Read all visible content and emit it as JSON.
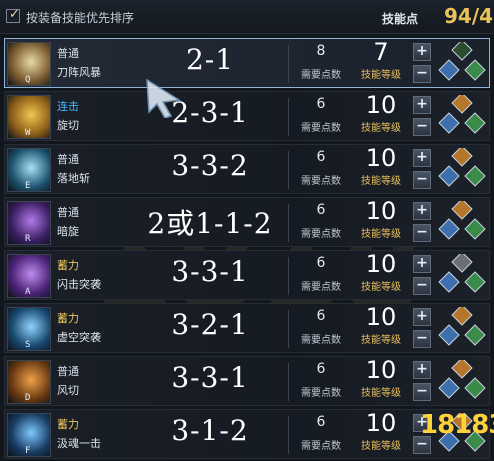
{
  "topbar": {
    "sort_label": "按装备技能优先排序",
    "skill_points_label": "技能点",
    "skill_points_value": "94/4"
  },
  "labels": {
    "cost": "需要点数",
    "level": "技能等级"
  },
  "skills": [
    {
      "key": "Q",
      "type": "普通",
      "name": "刀阵风暴",
      "build": "2-1",
      "cost": "8",
      "level": "7",
      "type_color": "#d6dde6",
      "icon_colors": [
        "#7a5a2e",
        "#e8d9a8"
      ],
      "gems": [
        "#2b4c2f",
        "#3d6fae",
        "#3a8a4a",
        "#2b4c2f"
      ]
    },
    {
      "key": "W",
      "type": "连击",
      "name": "旋切",
      "build": "2-3-1",
      "cost": "6",
      "level": "10",
      "type_color": "#4ab7ff",
      "icon_colors": [
        "#8a5e18",
        "#f3c550"
      ],
      "gems": [
        "#b5762a",
        "#3d6fae",
        "#3a8a4a",
        "#3d6fae"
      ]
    },
    {
      "key": "E",
      "type": "普通",
      "name": "落地斩",
      "build": "3-3-2",
      "cost": "6",
      "level": "10",
      "type_color": "#d6dde6",
      "icon_colors": [
        "#1e5470",
        "#a7e0f5"
      ],
      "gems": [
        "#b5762a",
        "#3d6fae",
        "#3a8a4a",
        "#3d6fae"
      ]
    },
    {
      "key": "R",
      "type": "普通",
      "name": "暗旋",
      "build": "2或1-1-2",
      "cost": "6",
      "level": "10",
      "type_color": "#d6dde6",
      "icon_colors": [
        "#3b1f63",
        "#b07ae8"
      ],
      "gems": [
        "#b5762a",
        "#3d6fae",
        "#3a8a4a",
        "#3d6fae"
      ]
    },
    {
      "key": "A",
      "type": "蓄力",
      "name": "闪击突袭",
      "build": "3-3-1",
      "cost": "6",
      "level": "10",
      "type_color": "#f0c85c",
      "icon_colors": [
        "#4a2276",
        "#c08bf0"
      ],
      "gems": [
        "#6b6f75",
        "#3d6fae",
        "#3a8a4a",
        "#6b6f75"
      ]
    },
    {
      "key": "S",
      "type": "蓄力",
      "name": "虚空突袭",
      "build": "3-2-1",
      "cost": "6",
      "level": "10",
      "type_color": "#f0c85c",
      "icon_colors": [
        "#18486e",
        "#8fd3ff"
      ],
      "gems": [
        "#b5762a",
        "#3d6fae",
        "#3a8a4a",
        "#3d6fae"
      ]
    },
    {
      "key": "D",
      "type": "普通",
      "name": "风切",
      "build": "3-3-1",
      "cost": "6",
      "level": "10",
      "type_color": "#d6dde6",
      "icon_colors": [
        "#6a3a12",
        "#f0a14a"
      ],
      "gems": [
        "#b5762a",
        "#3d6fae",
        "#3a8a4a",
        "#3d6fae"
      ]
    },
    {
      "key": "F",
      "type": "蓄力",
      "name": "汲魂一击",
      "build": "3-1-2",
      "cost": "6",
      "level": "10",
      "type_color": "#f0c85c",
      "icon_colors": [
        "#183c63",
        "#7ec8ff"
      ],
      "gems": [
        "#b5762a",
        "#3d6fae",
        "#3a8a4a",
        "#3d6fae"
      ]
    }
  ],
  "watermark": {
    "logo_text": "18183"
  }
}
